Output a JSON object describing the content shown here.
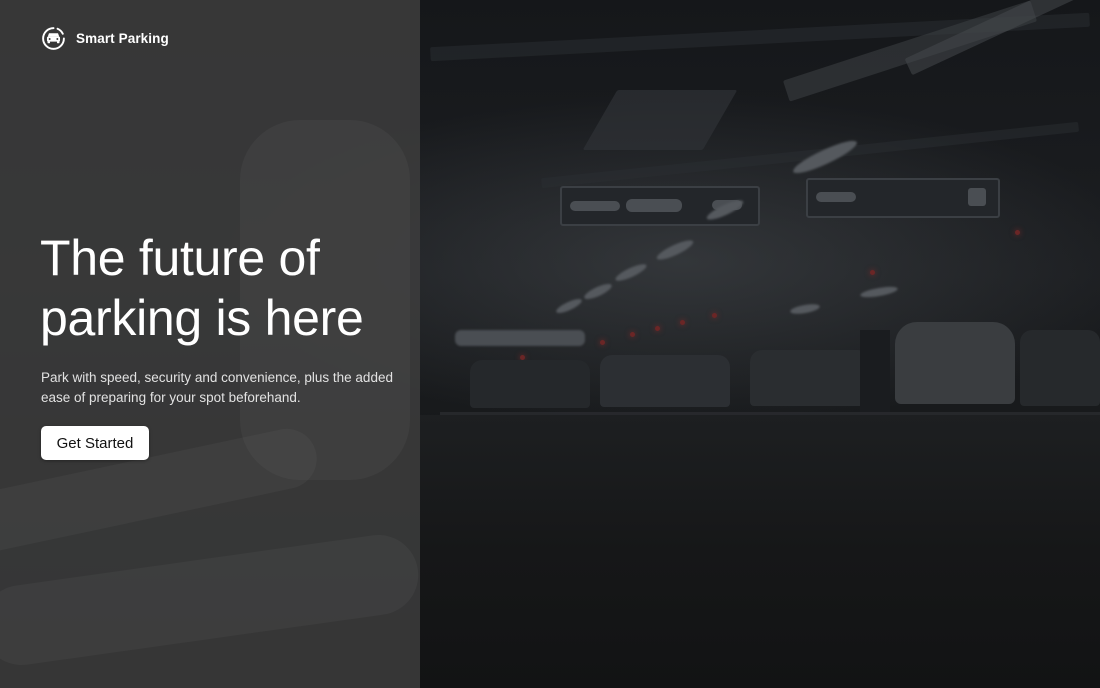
{
  "brand": {
    "name": "Smart Parking"
  },
  "hero": {
    "title_line1": "The future of",
    "title_line2": "parking is here",
    "subtitle_line1": "Park with speed, security and convenience, plus the added",
    "subtitle_line2": "ease of preparing for your spot beforehand.",
    "cta_label": "Get Started"
  },
  "colors": {
    "panel_overlay": "#3c3c3c",
    "button_background": "#ffffff",
    "button_text": "#111111",
    "text_primary": "#ffffff"
  },
  "icons": {
    "brand_logo": "car-circle-icon"
  }
}
